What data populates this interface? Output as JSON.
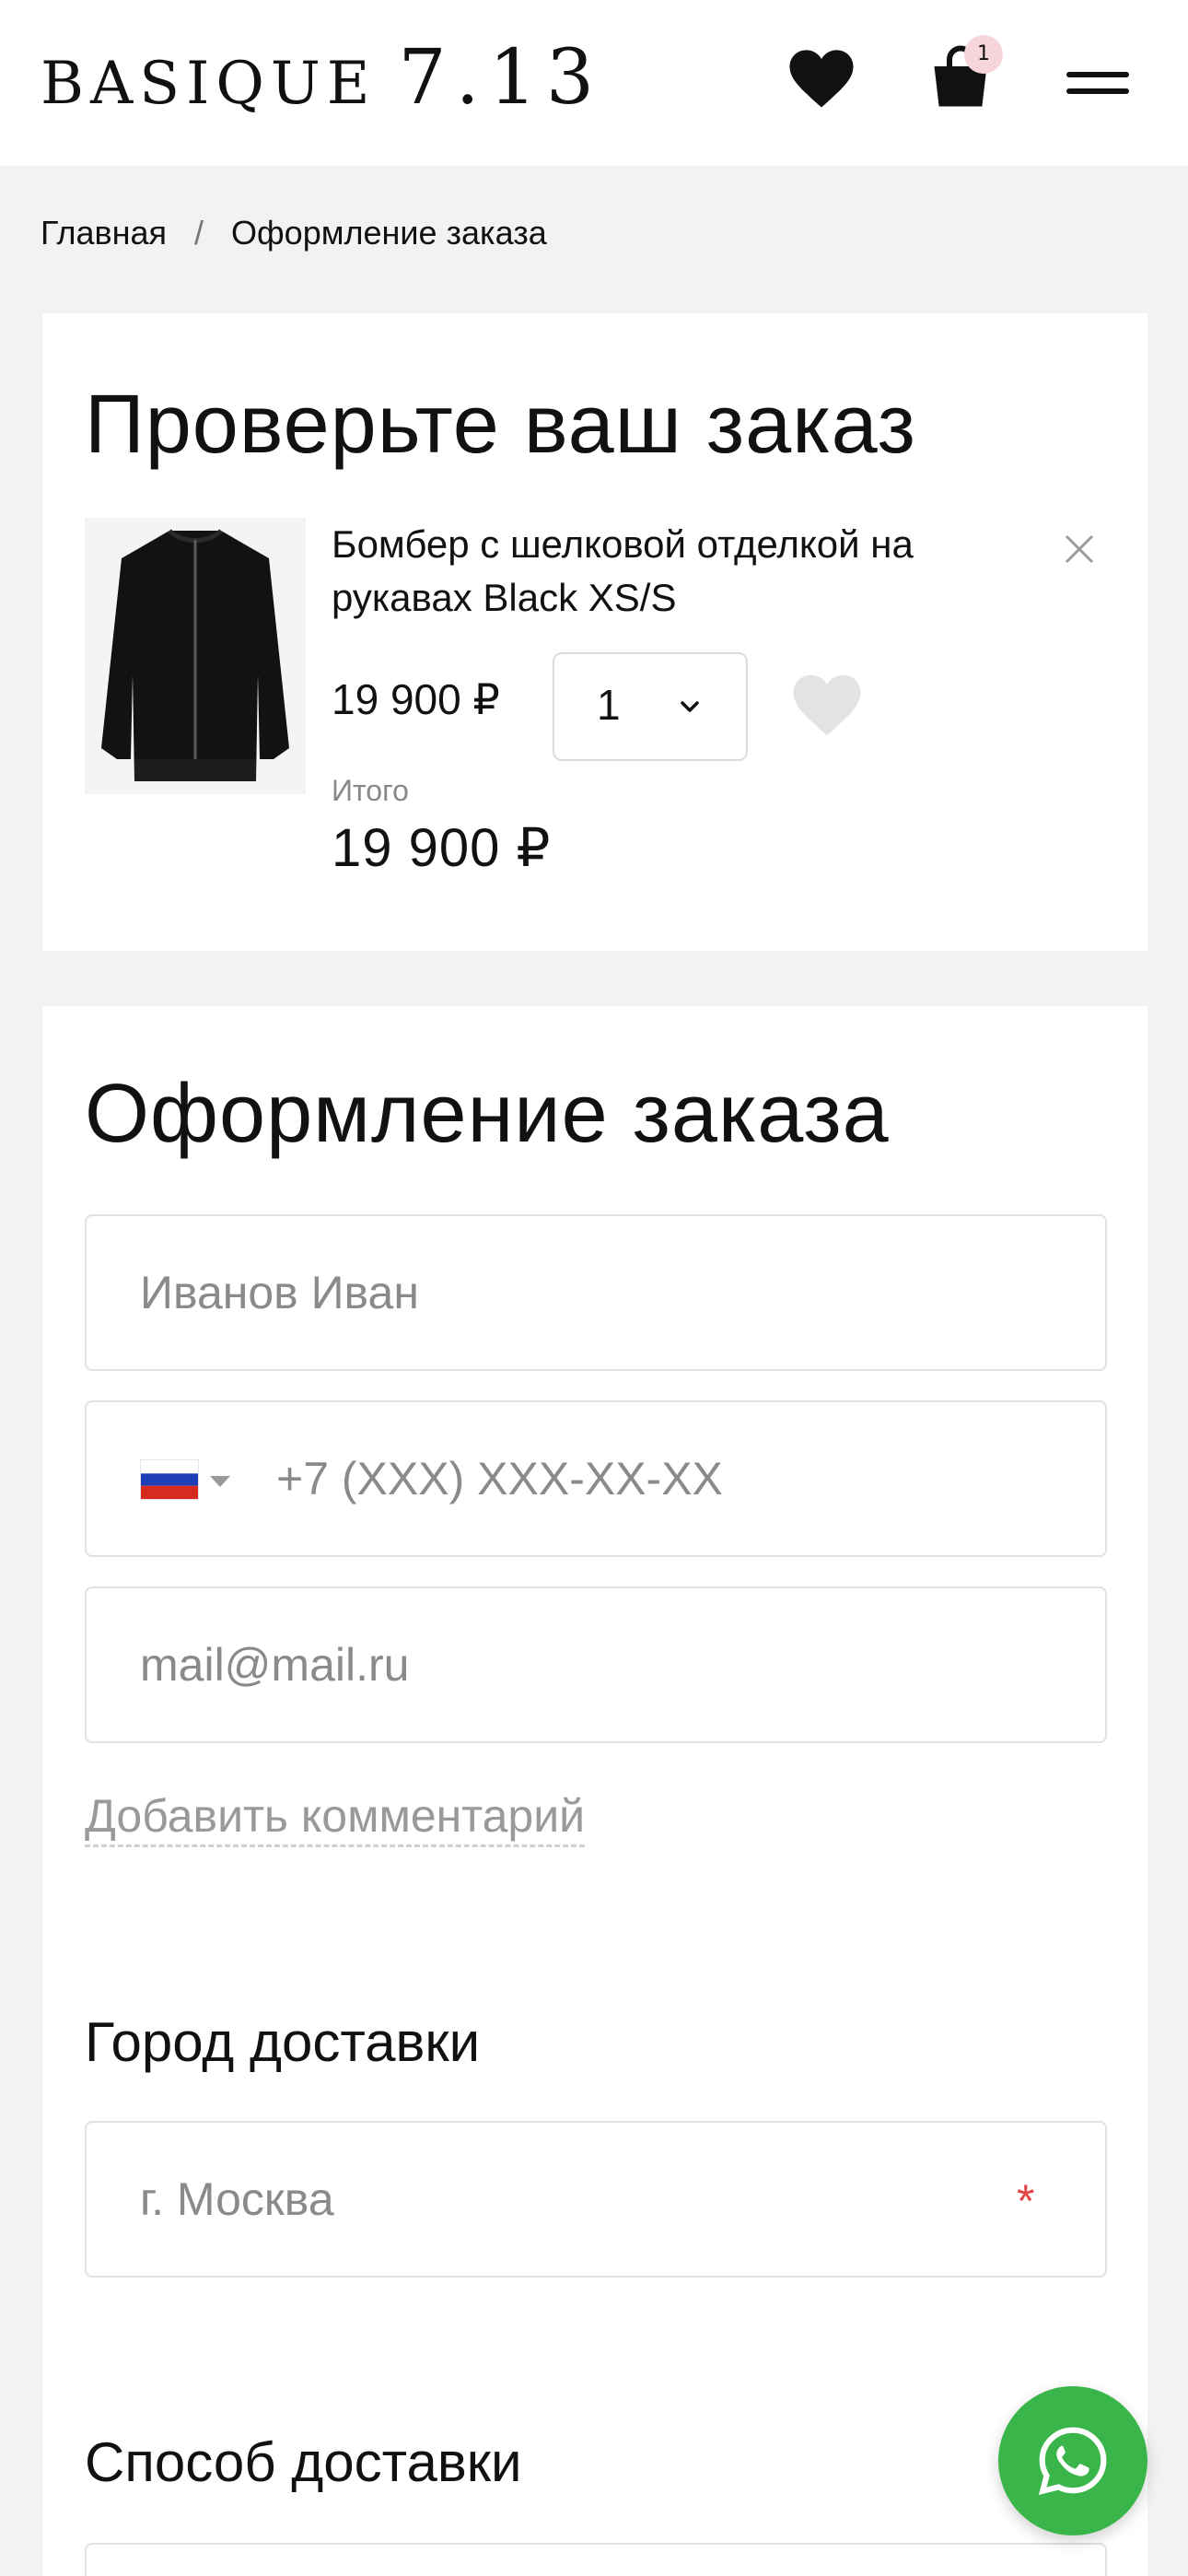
{
  "header": {
    "logo_word": "BASIQUE",
    "logo_num": "7.13",
    "cart_count": "1",
    "icons": [
      "heart-icon",
      "shopping-bag-icon",
      "menu-icon"
    ]
  },
  "breadcrumb": {
    "home": "Главная",
    "separator": "/",
    "current": "Оформление заказа"
  },
  "review": {
    "title": "Проверьте ваш заказ",
    "item": {
      "name": "Бомбер с шелковой отделкой на рукавах Black XS/S",
      "price": "19 900 ₽",
      "quantity": "1"
    },
    "total_label": "Итого",
    "total_value": "19 900 ₽"
  },
  "checkout": {
    "title": "Оформление заказа",
    "name_placeholder": "Иванов Иван",
    "phone_placeholder": "+7 (XXX) XXX-XX-XX",
    "email_placeholder": "mail@mail.ru",
    "add_comment": "Добавить комментарий",
    "city_heading": "Город доставки",
    "city_placeholder": "г. Москва",
    "required_mark": "*",
    "delivery_heading": "Способ доставки"
  },
  "colors": {
    "accent_whatsapp": "#39b54a",
    "required": "#e04444",
    "badge": "#f6d6da",
    "background": "#f3f2f0"
  }
}
